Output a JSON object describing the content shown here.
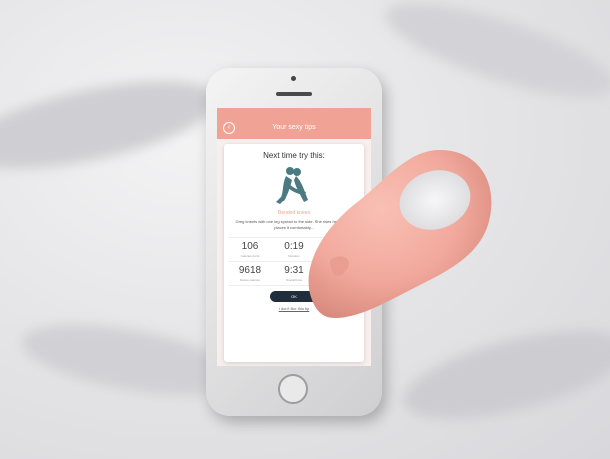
{
  "app": {
    "status_text": "",
    "header_title": "Your sexy tips"
  },
  "card": {
    "title": "Next time try this:",
    "position_name": "Bended knees",
    "description": "Greg kneels with one leg spread to the side. She rises her leg and places it comfortably...",
    "stats": [
      {
        "value": "106",
        "label": "Calories burnt"
      },
      {
        "value": "0:19",
        "label": "Duration"
      },
      {
        "value": "",
        "label": ""
      },
      {
        "value": "9618",
        "label": "Dance calories"
      },
      {
        "value": "9:31",
        "label": "Overall time"
      },
      {
        "value": "",
        "label": "Positions Tried"
      }
    ],
    "ok_label": "OK",
    "dislike_label": "I don't like this tip"
  },
  "colors": {
    "accent": "#f0a394",
    "device": "#f2a99d",
    "button": "#1f2d3d"
  }
}
